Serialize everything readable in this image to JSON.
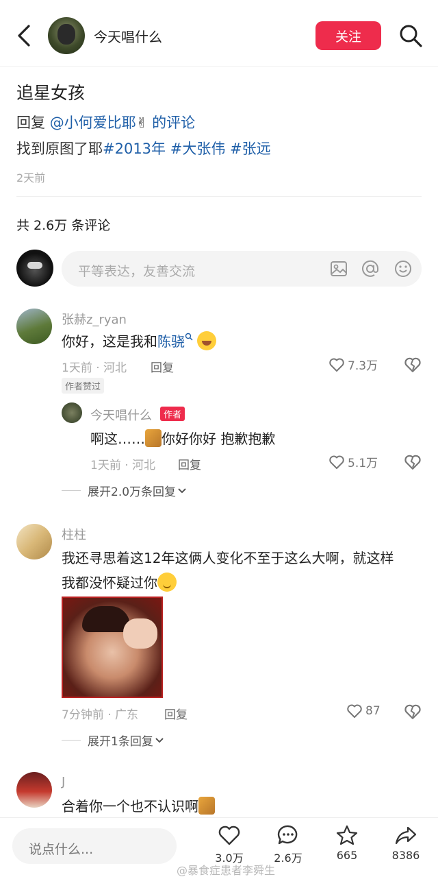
{
  "header": {
    "back_icon": "back-chevron-icon",
    "author_name": "今天唱什么",
    "follow_label": "关注",
    "search_icon": "search-icon",
    "accent": "#ee2c4c"
  },
  "post": {
    "title": "追星女孩",
    "reply_prefix": "回复 ",
    "mention": "@小何爱比耶",
    "emoji": "✌",
    "reply_suffix": " 的评论",
    "line2_text": "找到原图了耶",
    "tags": [
      "#2013年",
      "#大张伟",
      "#张远"
    ],
    "time": "2天前"
  },
  "comments_header": {
    "count_text": "共 2.6万 条评论",
    "input_placeholder": "平等表达，友善交流",
    "icons": [
      "image-icon",
      "at-icon",
      "emoji-icon"
    ]
  },
  "comments": [
    {
      "user": "张赫z_ryan",
      "text_before": "你好，这是我和",
      "mention": "陈骁",
      "mention_icon": "search-icon",
      "time_loc": "1天前 · 河北",
      "reply_label": "回复",
      "likes": "7.3万",
      "badge": "作者赞过",
      "reply": {
        "user": "今天唱什么",
        "badge": "作者",
        "text_before": "啊这……",
        "text_after": "你好你好  抱歉抱歉",
        "time_loc": "1天前 · 河北",
        "reply_label": "回复",
        "likes": "5.1万"
      },
      "expand": "展开2.0万条回复"
    },
    {
      "user": "柱柱",
      "text_line1": "我还寻思着这12年这俩人变化不至于这么大啊，就这样",
      "text_line2": "我都没怀疑过你",
      "time_loc": "7分钟前 · 广东",
      "reply_label": "回复",
      "likes": "87",
      "expand": "展开1条回复"
    },
    {
      "user": "J",
      "text": "合着你一个也不认识啊"
    }
  ],
  "bottom": {
    "placeholder": "说点什么...",
    "like_count": "3.0万",
    "comment_count": "2.6万",
    "star_count": "665",
    "share_count": "8386",
    "watermark": "@暴食症患者李舜生"
  }
}
